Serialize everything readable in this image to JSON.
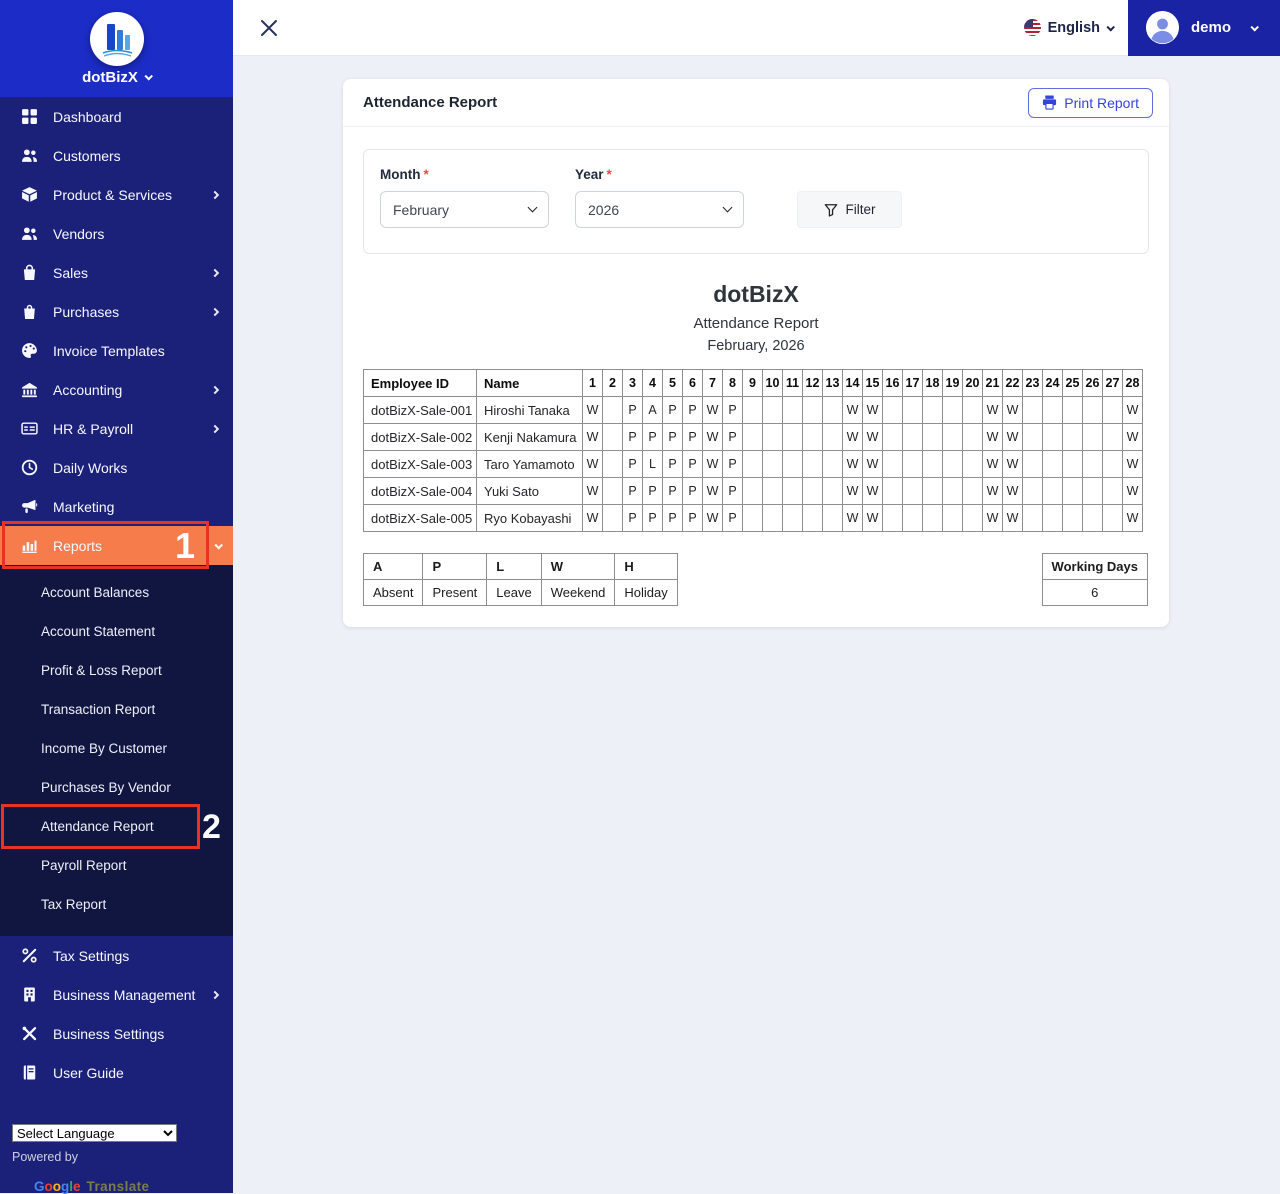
{
  "brand": {
    "name": "dotBizX"
  },
  "topbar": {
    "language": "English",
    "user": "demo",
    "icons": [
      "close-icon",
      "us-flag-icon",
      "chevron-down-icon",
      "user-avatar"
    ]
  },
  "sidebar": {
    "items": [
      {
        "label": "Dashboard",
        "icon": "dashboard-icon",
        "chevron": false,
        "active": false
      },
      {
        "label": "Customers",
        "icon": "users-icon",
        "chevron": false,
        "active": false
      },
      {
        "label": "Product & Services",
        "icon": "box-icon",
        "chevron": true,
        "active": false
      },
      {
        "label": "Vendors",
        "icon": "users-icon",
        "chevron": false,
        "active": false
      },
      {
        "label": "Sales",
        "icon": "shopping-bag-icon",
        "chevron": true,
        "active": false
      },
      {
        "label": "Purchases",
        "icon": "purchase-bag-icon",
        "chevron": true,
        "active": false
      },
      {
        "label": "Invoice Templates",
        "icon": "palette-icon",
        "chevron": false,
        "active": false
      },
      {
        "label": "Accounting",
        "icon": "bank-icon",
        "chevron": true,
        "active": false
      },
      {
        "label": "HR & Payroll",
        "icon": "payroll-icon",
        "chevron": true,
        "active": false
      },
      {
        "label": "Daily Works",
        "icon": "clock-icon",
        "chevron": false,
        "active": false
      },
      {
        "label": "Marketing",
        "icon": "megaphone-icon",
        "chevron": false,
        "active": false
      },
      {
        "label": "Reports",
        "icon": "bar-chart-icon",
        "chevron": false,
        "active": true
      }
    ],
    "report_submenu": [
      "Account Balances",
      "Account Statement",
      "Profit & Loss Report",
      "Transaction Report",
      "Income By Customer",
      "Purchases By Vendor",
      "Attendance Report",
      "Payroll Report",
      "Tax Report"
    ],
    "highlighted_submenu": "Attendance Report",
    "bottom_items": [
      {
        "label": "Tax Settings",
        "icon": "percent-icon",
        "chevron": false
      },
      {
        "label": "Business Management",
        "icon": "building-icon",
        "chevron": true
      },
      {
        "label": "Business Settings",
        "icon": "tools-icon",
        "chevron": false
      },
      {
        "label": "User Guide",
        "icon": "book-icon",
        "chevron": false
      }
    ],
    "language_select": "Select Language",
    "powered_by": "Powered by",
    "google_translate": {
      "google": "Google",
      "translate": "Translate"
    }
  },
  "annotations": {
    "step1": "1",
    "step2": "2"
  },
  "report": {
    "card_title": "Attendance Report",
    "print_label": "Print Report",
    "filters": {
      "month_label": "Month",
      "month_value": "February",
      "year_label": "Year",
      "year_value": "2026",
      "filter_label": "Filter"
    },
    "heading": {
      "company": "dotBizX",
      "title": "Attendance Report",
      "period": "February, 2026"
    },
    "table": {
      "headers": [
        "Employee ID",
        "Name"
      ],
      "day_headers": [
        "1",
        "2",
        "3",
        "4",
        "5",
        "6",
        "7",
        "8",
        "9",
        "10",
        "11",
        "12",
        "13",
        "14",
        "15",
        "16",
        "17",
        "18",
        "19",
        "20",
        "21",
        "22",
        "23",
        "24",
        "25",
        "26",
        "27",
        "28"
      ],
      "rows": [
        {
          "id": "dotBizX-Sale-001",
          "name": "Hiroshi Tanaka",
          "days": [
            "W",
            "",
            "P",
            "A",
            "P",
            "P",
            "W",
            "P",
            "",
            "",
            "",
            "",
            "",
            "W",
            "W",
            "",
            "",
            "",
            "",
            "",
            "W",
            "W",
            "",
            "",
            "",
            "",
            "",
            "W"
          ]
        },
        {
          "id": "dotBizX-Sale-002",
          "name": "Kenji Nakamura",
          "days": [
            "W",
            "",
            "P",
            "P",
            "P",
            "P",
            "W",
            "P",
            "",
            "",
            "",
            "",
            "",
            "W",
            "W",
            "",
            "",
            "",
            "",
            "",
            "W",
            "W",
            "",
            "",
            "",
            "",
            "",
            "W"
          ]
        },
        {
          "id": "dotBizX-Sale-003",
          "name": "Taro Yamamoto",
          "days": [
            "W",
            "",
            "P",
            "L",
            "P",
            "P",
            "W",
            "P",
            "",
            "",
            "",
            "",
            "",
            "W",
            "W",
            "",
            "",
            "",
            "",
            "",
            "W",
            "W",
            "",
            "",
            "",
            "",
            "",
            "W"
          ]
        },
        {
          "id": "dotBizX-Sale-004",
          "name": "Yuki Sato",
          "days": [
            "W",
            "",
            "P",
            "P",
            "P",
            "P",
            "W",
            "P",
            "",
            "",
            "",
            "",
            "",
            "W",
            "W",
            "",
            "",
            "",
            "",
            "",
            "W",
            "W",
            "",
            "",
            "",
            "",
            "",
            "W"
          ]
        },
        {
          "id": "dotBizX-Sale-005",
          "name": "Ryo Kobayashi",
          "days": [
            "W",
            "",
            "P",
            "P",
            "P",
            "P",
            "W",
            "P",
            "",
            "",
            "",
            "",
            "",
            "W",
            "W",
            "",
            "",
            "",
            "",
            "",
            "W",
            "W",
            "",
            "",
            "",
            "",
            "",
            "W"
          ]
        }
      ]
    },
    "legend": {
      "headers": [
        "A",
        "P",
        "L",
        "W",
        "H"
      ],
      "values": [
        "Absent",
        "Present",
        "Leave",
        "Weekend",
        "Holiday"
      ]
    },
    "working_days": {
      "label": "Working Days",
      "value": "6"
    }
  },
  "colors": {
    "sidebar_top": "#1c2cc7",
    "sidebar_nav": "#1b2178",
    "sidebar_submenu": "#111640",
    "highlight_orange": "#f77c4c",
    "annotation_red": "#e93223",
    "topbar_user_bg": "#1a23a3",
    "accent_blue": "#3443d8",
    "page_bg": "#eef0f7",
    "required_red": "#e5484d",
    "google_letters": [
      "#4285F4",
      "#EA4335",
      "#FBBC05",
      "#4285F4",
      "#34A853",
      "#EA4335"
    ]
  }
}
